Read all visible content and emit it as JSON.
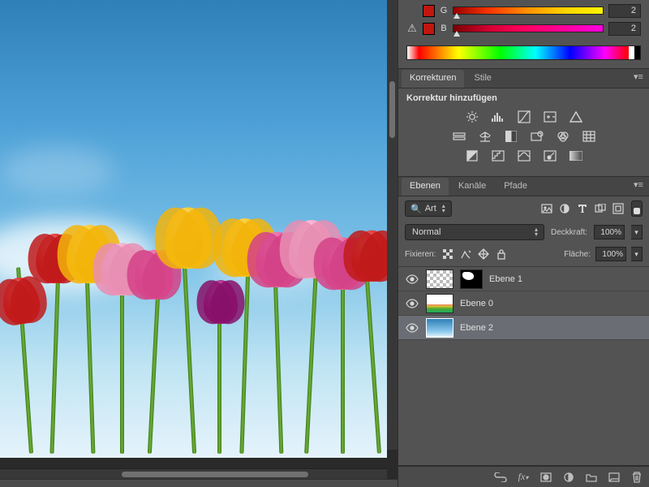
{
  "color_panel": {
    "rows": [
      {
        "channel": "G",
        "value": "2",
        "warn": false,
        "swatch": "#c0160f",
        "gradient": "linear-gradient(to right,#960000,#ff3800,#ff9300,#ffd400,#fff400)",
        "knob_pct": 2
      },
      {
        "channel": "B",
        "value": "2",
        "warn": true,
        "swatch": "#c0160f",
        "gradient": "linear-gradient(to right,#7a0000,#d80034,#ff0065,#ff009d,#ff00e0)",
        "knob_pct": 2
      }
    ]
  },
  "korrekturen": {
    "tabs": [
      {
        "label": "Korrekturen",
        "active": true
      },
      {
        "label": "Stile",
        "active": false
      }
    ],
    "title": "Korrektur hinzufügen",
    "rows": [
      [
        "brightness-contrast-icon",
        "levels-icon",
        "curves-icon",
        "exposure-icon",
        "vibrance-icon"
      ],
      [
        "hue-sat-icon",
        "color-balance-icon",
        "bw-icon",
        "photo-filter-icon",
        "channel-mixer-icon",
        "color-lookup-icon"
      ],
      [
        "invert-icon",
        "posterize-icon",
        "threshold-icon",
        "selective-color-icon",
        "gradient-map-icon"
      ]
    ]
  },
  "layers_panel": {
    "tabs": [
      {
        "label": "Ebenen",
        "active": true
      },
      {
        "label": "Kanäle",
        "active": false
      },
      {
        "label": "Pfade",
        "active": false
      }
    ],
    "filter_label": "Art",
    "filter_icons": [
      "pixel-filter-icon",
      "adjustment-filter-icon",
      "type-filter-icon",
      "shape-filter-icon",
      "smartobject-filter-icon"
    ],
    "blend_mode": "Normal",
    "opacity_label": "Deckkraft:",
    "opacity_value": "100%",
    "lock_label": "Fixieren:",
    "fill_label": "Fläche:",
    "fill_value": "100%",
    "lock_icons": [
      "lock-transparent-icon",
      "lock-image-icon",
      "lock-position-icon",
      "lock-all-icon"
    ],
    "layers": [
      {
        "name": "Ebene 1",
        "visible": true,
        "selected": false,
        "thumb": "checker",
        "mask": true
      },
      {
        "name": "Ebene 0",
        "visible": true,
        "selected": false,
        "thumb": "tulips",
        "mask": false
      },
      {
        "name": "Ebene 2",
        "visible": true,
        "selected": true,
        "thumb": "sky",
        "mask": false
      }
    ],
    "bottom_icons": [
      "link-layers-icon",
      "layer-style-icon",
      "layer-mask-icon",
      "new-adjustment-icon",
      "new-group-icon",
      "new-layer-icon",
      "delete-layer-icon"
    ]
  }
}
